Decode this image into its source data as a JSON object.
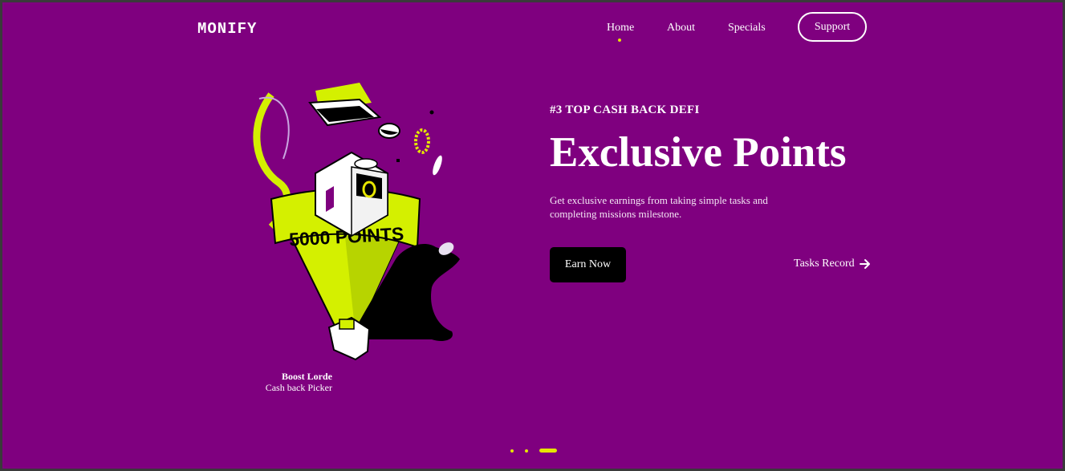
{
  "brand": {
    "logo": "MONIFY"
  },
  "nav": {
    "items": [
      {
        "label": "Home",
        "active": true
      },
      {
        "label": "About",
        "active": false
      },
      {
        "label": "Specials",
        "active": false
      }
    ],
    "support_label": "Support"
  },
  "hero": {
    "eyebrow": "#3 TOP CASH BACK DEFI",
    "title": "Exclusive Points",
    "description": "Get exclusive earnings from taking simple tasks and completing missions milestone.",
    "primary_cta": "Earn Now",
    "secondary_cta": "Tasks Record",
    "secondary_icon": "arrow-right-icon"
  },
  "illustration": {
    "ring_text": "5000 POINTS",
    "caption_name": "Boost Lorde",
    "caption_role": "Cash back Picker"
  },
  "carousel": {
    "slides": 3,
    "active_index": 2
  },
  "colors": {
    "background": "#7f007f",
    "accent": "#e6e600",
    "lime": "#d4f000",
    "button": "#000000"
  }
}
